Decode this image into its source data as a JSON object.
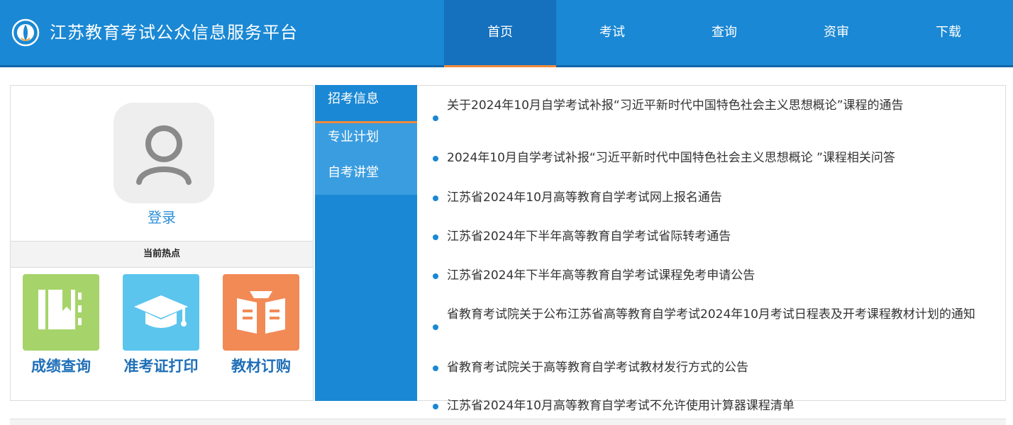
{
  "header": {
    "site_title": "江苏教育考试公众信息服务平台",
    "nav": [
      {
        "label": "首页",
        "active": true
      },
      {
        "label": "考试",
        "active": false
      },
      {
        "label": "查询",
        "active": false
      },
      {
        "label": "资审",
        "active": false
      },
      {
        "label": "下载",
        "active": false
      }
    ]
  },
  "left": {
    "login_label": "登录",
    "hot_title": "当前热点",
    "quick_links": [
      {
        "label": "成绩查询",
        "color": "#a6d46a",
        "icon": "book-icon"
      },
      {
        "label": "准考证打印",
        "color": "#5bc5ee",
        "icon": "graduation-cap-icon"
      },
      {
        "label": "教材订购",
        "color": "#f28a56",
        "icon": "textbook-icon"
      }
    ]
  },
  "tabs": [
    {
      "label": "招考信息",
      "active": true
    },
    {
      "label": "专业计划",
      "active": false
    },
    {
      "label": "自考讲堂",
      "active": false
    }
  ],
  "news": [
    "关于2024年10月自学考试补报“习近平新时代中国特色社会主义思想概论”课程的通告",
    "2024年10月自学考试补报“习近平新时代中国特色社会主义思想概论 ”课程相关问答",
    "江苏省2024年10月高等教育自学考试网上报名通告",
    "江苏省2024年下半年高等教育自学考试省际转考通告",
    "江苏省2024年下半年高等教育自学考试课程免考申请公告",
    "省教育考试院关于公布江苏省高等教育自学考试2024年10月考试日程表及开考课程教材计划的通知",
    "省教育考试院关于高等教育自学考试教材发行方式的公告",
    "江苏省2024年10月高等教育自学考试不允许使用计算器课程清单"
  ],
  "colors": {
    "header_bg": "#1a88d4",
    "accent": "#f08a3c",
    "link": "#2d8fd8"
  }
}
